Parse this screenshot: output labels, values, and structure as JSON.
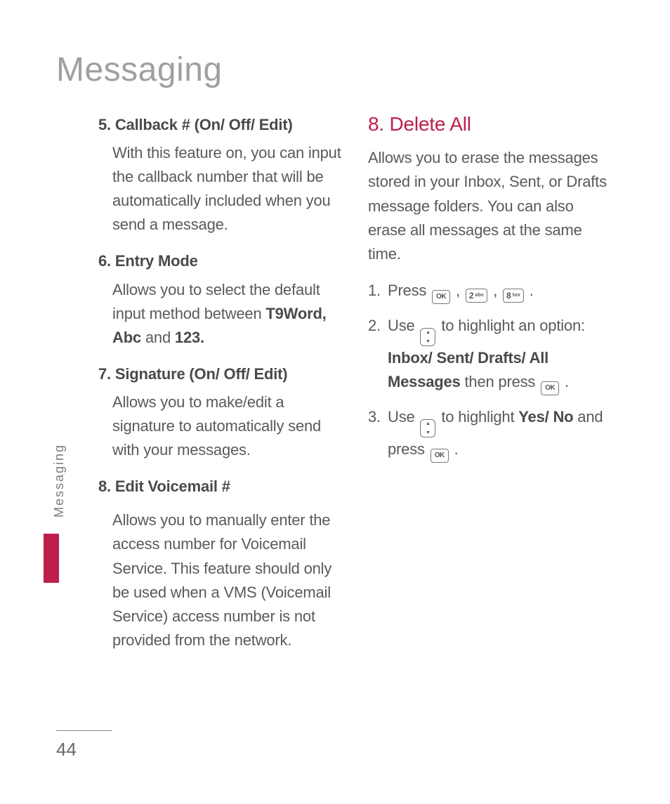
{
  "page": {
    "title": "Messaging",
    "side_label": "Messaging",
    "number": "44"
  },
  "left": {
    "i5": {
      "head": "5. Callback # (On/ Off/ Edit)",
      "body": "With this feature on, you can input the callback number that will be automatically included when you send a message."
    },
    "i6": {
      "head": "6. Entry Mode",
      "body_pre": "Allows you to select the default input method between ",
      "body_bold": "T9Word, Abc",
      "body_mid": " and ",
      "body_bold2": "123."
    },
    "i7": {
      "head": "7. Signature (On/ Off/ Edit)",
      "body": "Allows you to make/edit a signature to automatically send with your messages."
    },
    "i8": {
      "head": "8. Edit Voicemail #",
      "body": "Allows you to manually enter the access number for Voicemail Service. This feature should only be used when a VMS (Voicemail Service) access number is not provided from the network."
    }
  },
  "right": {
    "head": "8. Delete All",
    "intro": "Allows you to erase the messages stored in your Inbox, Sent, or Drafts message folders. You can also erase all messages at the same time.",
    "s1_pre": "Press ",
    "s2_pre": "Use ",
    "s2_mid": " to highlight an option: ",
    "s2_bold": "Inbox/ Sent/ Drafts/ All Messages",
    "s2_post": " then press ",
    "s3_pre": "Use ",
    "s3_mid": " to highlight ",
    "s3_bold": "Yes/ No",
    "s3_post": " and press ",
    "keys": {
      "two": "2",
      "two_ltr": "abc",
      "eight": "8",
      "eight_ltr": "tuv"
    },
    "nums": {
      "n1": "1.",
      "n2": "2.",
      "n3": "3."
    }
  }
}
